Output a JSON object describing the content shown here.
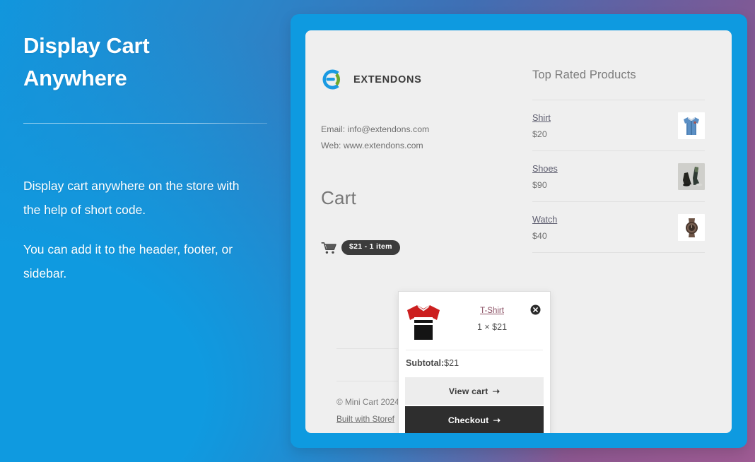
{
  "theme": {
    "accent_blue": "#0e9ae0",
    "card_bg": "#efefef",
    "dark_button": "#2e2e2e",
    "logo_blue": "#1a9ae2",
    "logo_green": "#6fa82c"
  },
  "left_panel": {
    "headline_line1": "Display Cart",
    "headline_line2": "Anywhere",
    "paragraph1": "Display cart anywhere on the store with the help of short code.",
    "paragraph2": "You can add it to the header, footer, or sidebar."
  },
  "store": {
    "brand_name": "EXTENDONS",
    "email": "Email: info@extendons.com",
    "web": "Web: www.extendons.com",
    "cart_heading": "Cart",
    "cart_pill": "$21 -  1 item",
    "footer_copyright": "© Mini Cart 2024",
    "footer_built": "Built with Storef"
  },
  "products": {
    "title": "Top Rated Products",
    "items": [
      {
        "name": "Shirt",
        "price": "$20",
        "thumb": "shirt-thumbnail"
      },
      {
        "name": "Shoes",
        "price": "$90",
        "thumb": "shoes-thumbnail"
      },
      {
        "name": "Watch",
        "price": "$40",
        "thumb": "watch-thumbnail"
      }
    ]
  },
  "mini_cart": {
    "item_title": "T-Shirt",
    "item_qty": "1 × $21",
    "remove_icon": "close-circle-icon",
    "subtotal_label": "Subtotal:",
    "subtotal_value": "$21",
    "view_cart_label": "View cart",
    "checkout_label": "Checkout",
    "arrow": "➝"
  }
}
